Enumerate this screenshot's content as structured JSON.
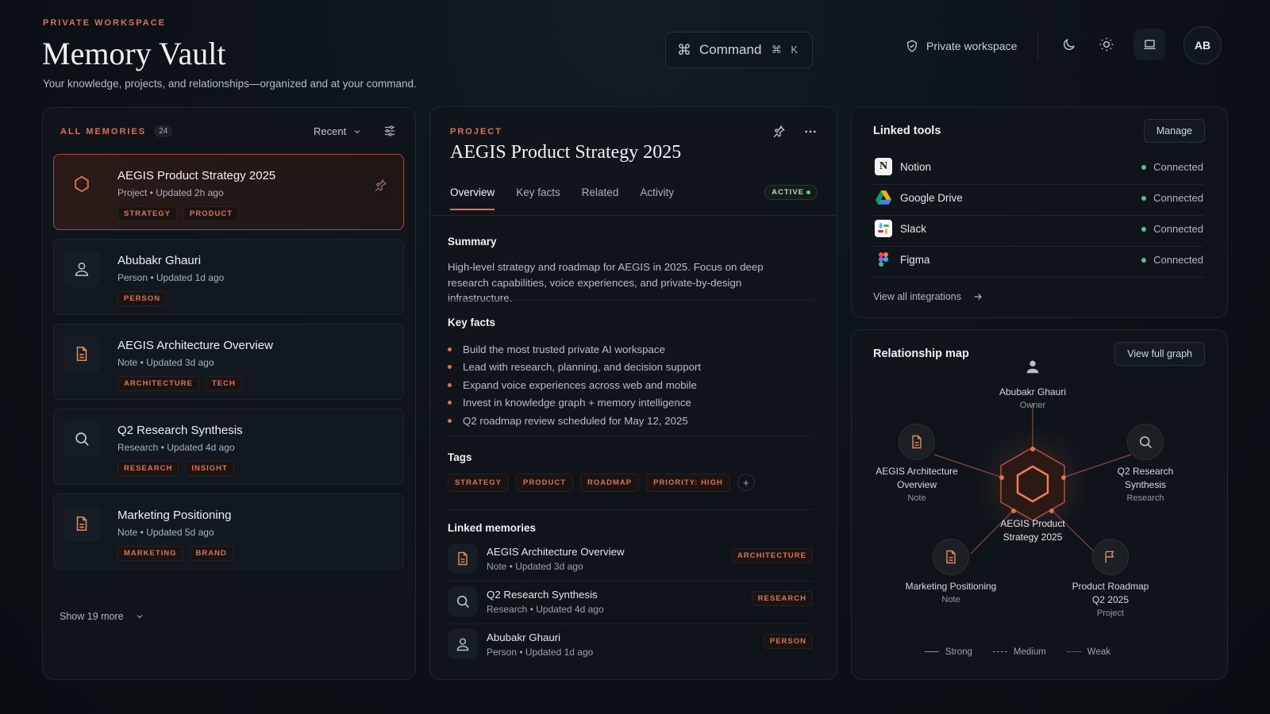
{
  "header": {
    "eyebrow": "PRIVATE WORKSPACE",
    "title": "Memory Vault",
    "subtitle": "Your knowledge, projects, and relationships—organized and at your command.",
    "command_label": "Command",
    "command_shortcut": "⌘ K",
    "workspace_label": "Private workspace",
    "avatar_initials": "AB"
  },
  "memories": {
    "title": "ALL MEMORIES",
    "count": "24",
    "sort_label": "Recent",
    "items": [
      {
        "name": "AEGIS Product Strategy 2025",
        "meta": "Project • Updated 2h ago",
        "tags": [
          "STRATEGY",
          "PRODUCT"
        ],
        "icon": "hexagon-icon"
      },
      {
        "name": "Abubakr Ghauri",
        "meta": "Person • Updated 1d ago",
        "tags": [
          "PERSON"
        ],
        "icon": "person-icon"
      },
      {
        "name": "AEGIS Architecture Overview",
        "meta": "Note • Updated 3d ago",
        "tags": [
          "ARCHITECTURE",
          "TECH"
        ],
        "icon": "document-icon"
      },
      {
        "name": "Q2 Research Synthesis",
        "meta": "Research • Updated 4d ago",
        "tags": [
          "RESEARCH",
          "INSIGHT"
        ],
        "icon": "search-icon"
      },
      {
        "name": "Marketing Positioning",
        "meta": "Note • Updated 5d ago",
        "tags": [
          "MARKETING",
          "BRAND"
        ],
        "icon": "document-icon"
      }
    ],
    "show_more": "Show 19 more"
  },
  "detail": {
    "eyebrow": "PROJECT",
    "title": "AEGIS Product Strategy 2025",
    "tabs": [
      "Overview",
      "Key facts",
      "Related",
      "Activity"
    ],
    "status": "ACTIVE",
    "summary_heading": "Summary",
    "summary": "High-level strategy and roadmap for AEGIS in 2025. Focus on deep research capabilities, voice experiences, and private-by-design infrastructure.",
    "keyfacts_heading": "Key facts",
    "keyfacts": [
      "Build the most trusted private AI workspace",
      "Lead with research, planning, and decision support",
      "Expand voice experiences across web and mobile",
      "Invest in knowledge graph + memory intelligence",
      "Q2 roadmap review scheduled for May 12, 2025"
    ],
    "tags_heading": "Tags",
    "tags": [
      "STRATEGY",
      "PRODUCT",
      "ROADMAP",
      "PRIORITY: HIGH"
    ],
    "add_tag": "+",
    "linked_heading": "Linked memories",
    "linked": [
      {
        "name": "AEGIS Architecture Overview",
        "meta": "Note • Updated 3d ago",
        "tag": "ARCHITECTURE"
      },
      {
        "name": "Q2 Research Synthesis",
        "meta": "Research • Updated 4d ago",
        "tag": "RESEARCH"
      },
      {
        "name": "Abubakr Ghauri",
        "meta": "Person • Updated 1d ago",
        "tag": "PERSON"
      }
    ]
  },
  "tools": {
    "title": "Linked tools",
    "manage": "Manage",
    "items": [
      {
        "name": "Notion",
        "status": "Connected"
      },
      {
        "name": "Google Drive",
        "status": "Connected"
      },
      {
        "name": "Slack",
        "status": "Connected"
      },
      {
        "name": "Figma",
        "status": "Connected"
      }
    ],
    "view_all": "View all integrations"
  },
  "graph": {
    "title": "Relationship map",
    "view_full": "View full graph",
    "center": {
      "label": "AEGIS Product Strategy 2025"
    },
    "nodes": [
      {
        "label": "Abubakr Ghauri",
        "sub": "Owner"
      },
      {
        "label": "AEGIS Architecture Overview",
        "sub": "Note"
      },
      {
        "label": "Q2 Research Synthesis",
        "sub": "Research"
      },
      {
        "label": "Marketing Positioning",
        "sub": "Note"
      },
      {
        "label": "Product Roadmap Q2 2025",
        "sub": "Project"
      }
    ],
    "legend": [
      "Strong",
      "Medium",
      "Weak"
    ]
  },
  "colors": {
    "accent": "#e0714f",
    "connected": "#53c47f",
    "background": "#0c1117"
  }
}
